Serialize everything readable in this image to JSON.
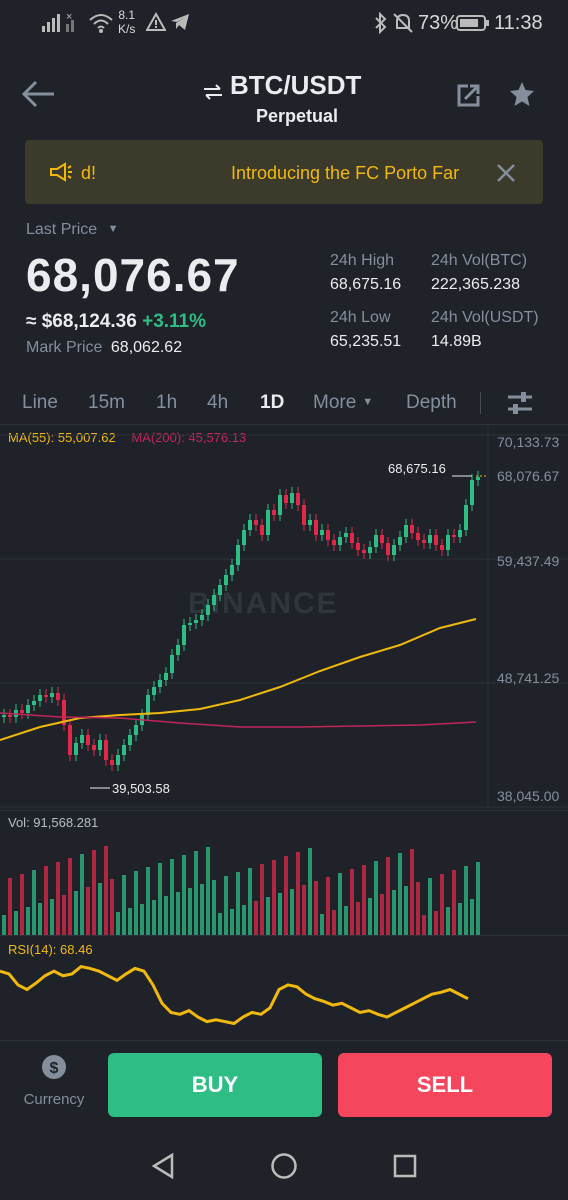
{
  "status_bar": {
    "net_speed_top": "8.1",
    "net_speed_unit": "K/s",
    "battery": "73%",
    "time": "11:38"
  },
  "header": {
    "pair": "BTC/USDT",
    "contract": "Perpetual"
  },
  "banner": {
    "prefix": "d!",
    "text": "Introducing the FC Porto Far"
  },
  "price": {
    "last_label": "Last Price",
    "last": "68,076.67",
    "approx_usd": "≈ $68,124.36",
    "change": "+3.11%",
    "mark_label": "Mark Price",
    "mark": "68,062.62"
  },
  "stats": {
    "high_label": "24h High",
    "high": "68,675.16",
    "vol_btc_label": "24h Vol(BTC)",
    "vol_btc": "222,365.238",
    "low_label": "24h Low",
    "low": "65,235.51",
    "vol_usdt_label": "24h Vol(USDT)",
    "vol_usdt": "14.89B"
  },
  "tabs": [
    "Line",
    "15m",
    "1h",
    "4h",
    "1D",
    "More",
    "Depth"
  ],
  "active_tab": "1D",
  "chart": {
    "ma55": "MA(55): 55,007.62",
    "ma200": "MA(200): 45,576.13",
    "y_labels": [
      "70,133.73",
      "59,437.49",
      "48,741.25",
      "38,045.00"
    ],
    "current_price_tag": "68,076.67",
    "high_marker": "68,675.16",
    "low_marker": "39,503.58",
    "watermark": "BINANCE",
    "vol_label": "Vol: 91,568.281",
    "rsi_label": "RSI(14): 68.46"
  },
  "colors": {
    "up": "#2ebd85",
    "down": "#e0294a",
    "ma55": "#f0b90b",
    "ma200": "#c2255c",
    "rsi": "#f0b90b"
  },
  "bottom": {
    "currency_label": "Currency",
    "buy_label": "BUY",
    "sell_label": "SELL"
  }
}
